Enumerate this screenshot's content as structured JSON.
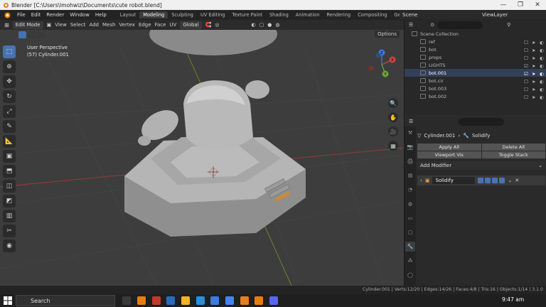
{
  "window": {
    "title": "Blender [C:\\Users\\lmohwiz\\Documents\\cute robot.blend]"
  },
  "menubar": {
    "items": [
      "File",
      "Edit",
      "Render",
      "Window",
      "Help"
    ],
    "workspaces": [
      "Layout",
      "Modeling",
      "Sculpting",
      "UV Editing",
      "Texture Paint",
      "Shading",
      "Animation",
      "Rendering",
      "Compositing",
      "Geometry Nod"
    ],
    "active_workspace": "Modeling",
    "scene": "Scene",
    "view_layer": "ViewLayer"
  },
  "viewport": {
    "mode": "Edit Mode",
    "menus": [
      "View",
      "Select",
      "Add",
      "Mesh",
      "Vertex",
      "Edge",
      "Face",
      "UV"
    ],
    "transform_orientation": "Global",
    "options_label": "Options",
    "perspective_label": "User Perspective",
    "object_label": "(57) Cylinder.001",
    "gizmo_axes": [
      "X",
      "Y",
      "Z"
    ]
  },
  "outliner": {
    "root": "Scene Collection",
    "items": [
      {
        "name": "ref"
      },
      {
        "name": "bot"
      },
      {
        "name": "props"
      },
      {
        "name": "LIGHTS"
      },
      {
        "name": "bot.001"
      },
      {
        "name": "bot.cir"
      },
      {
        "name": "bot.003"
      },
      {
        "name": "bot.002"
      }
    ]
  },
  "properties": {
    "breadcrumb_object": "Cylinder.001",
    "breadcrumb_modifier": "Solidify",
    "buttons": [
      "Apply All",
      "Delete All",
      "Viewport Vis",
      "Toggle Stack"
    ],
    "add_modifier": "Add Modifier",
    "modifier_name": "Solidify"
  },
  "statusbar": {
    "stats": "Cylinder.001 | Verts:12/20 | Edges:14/26 | Faces:4/8 | Tris:16 | Objects:1/14 | 3.1.0"
  },
  "taskbar": {
    "search_label": "Search",
    "time": "9:47 am"
  },
  "colors": {
    "accent": "#4772b3",
    "viewport_bg": "#3d3d3d",
    "panel_bg": "#2b2b2b",
    "model_gray": "#b9b9b9"
  }
}
